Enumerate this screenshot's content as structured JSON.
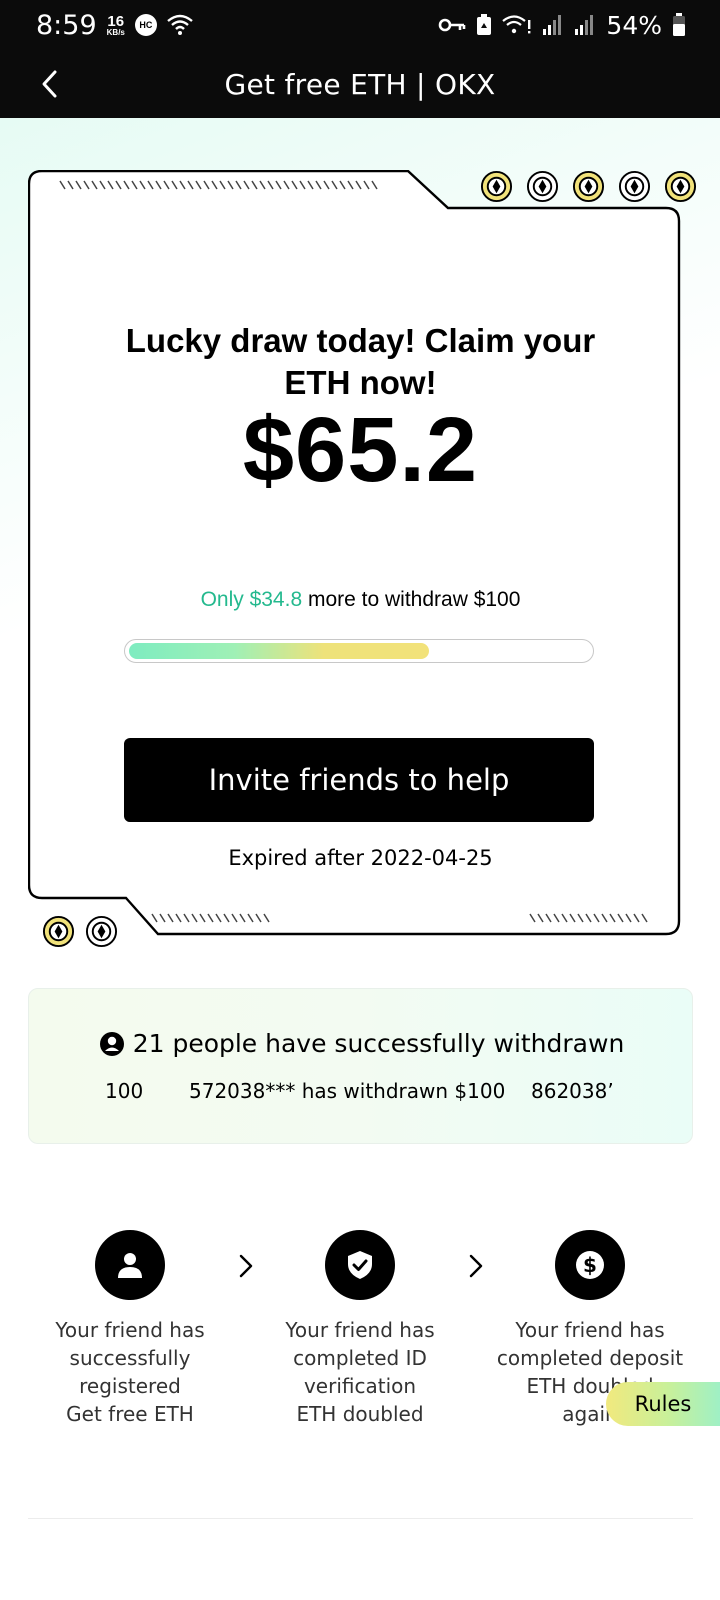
{
  "status_bar": {
    "time": "8:59",
    "speed_value": "16",
    "speed_unit": "KB/s",
    "hc_badge": "HC",
    "battery_pct": "54%"
  },
  "header": {
    "title": "Get free ETH | OKX",
    "back_icon": "chevron-left-icon"
  },
  "card": {
    "headline": "Lucky draw today! Claim your ETH now!",
    "amount": "$65.2",
    "progress_prefix": "Only ",
    "progress_highlight": "$34.8",
    "progress_suffix": " more to withdraw $100",
    "progress_fraction": 0.652,
    "invite_button": "Invite friends to help",
    "expire_text": "Expired after 2022-04-25",
    "accent_color": "#24b98e"
  },
  "withdraw_panel": {
    "title": "21 people have successfully withdrawn",
    "ticker": [
      "100",
      "572038*** has withdrawn $100",
      "862038’"
    ]
  },
  "steps": [
    {
      "icon": "person-icon",
      "text_lines": [
        "Your friend has",
        "successfully",
        "registered",
        "Get free ETH"
      ]
    },
    {
      "icon": "shield-check-icon",
      "text_lines": [
        "Your friend has",
        "completed ID",
        "verification",
        "ETH doubled"
      ]
    },
    {
      "icon": "dollar-coin-icon",
      "text_lines": [
        "Your friend has",
        "completed deposit",
        "ETH doubled",
        "again"
      ]
    }
  ],
  "rules_button": "Rules"
}
